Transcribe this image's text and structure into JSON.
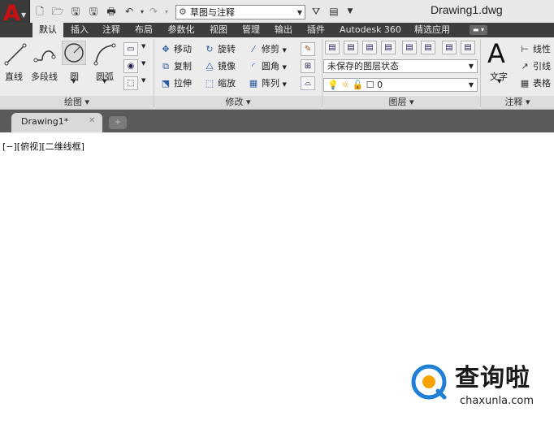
{
  "window": {
    "title": "Drawing1.dwg"
  },
  "app_button": {
    "logo": "A"
  },
  "quick_access": {
    "icons": [
      "new-file-icon",
      "open-folder-icon",
      "save-icon",
      "save-as-icon",
      "print-icon",
      "undo-icon",
      "redo-icon"
    ],
    "workspace": "草图与注释"
  },
  "tabs": [
    {
      "label": "默认",
      "active": true
    },
    {
      "label": "插入"
    },
    {
      "label": "注释"
    },
    {
      "label": "布局"
    },
    {
      "label": "参数化"
    },
    {
      "label": "视图"
    },
    {
      "label": "管理"
    },
    {
      "label": "输出"
    },
    {
      "label": "插件"
    },
    {
      "label": "Autodesk 360"
    },
    {
      "label": "精选应用"
    }
  ],
  "panels": {
    "draw": {
      "title": "绘图",
      "tools": {
        "line": "直线",
        "polyline": "多段线",
        "circle": "圆",
        "arc": "圆弧"
      }
    },
    "modify": {
      "title": "修改",
      "rows": [
        [
          "移动",
          "旋转",
          "修剪"
        ],
        [
          "复制",
          "镜像",
          "圆角"
        ],
        [
          "拉伸",
          "缩放",
          "阵列"
        ]
      ]
    },
    "layers": {
      "title": "图层",
      "state_combo": "未保存的图层状态",
      "layer_combo": "0"
    },
    "annotation": {
      "title": "注释",
      "text": "文字",
      "linear": "线性",
      "leader": "引线",
      "table": "表格"
    }
  },
  "file_tab": {
    "name": "Drawing1*"
  },
  "viewport": {
    "label": "[−][俯视][二维线框]"
  },
  "watermark": {
    "cn": "查询啦",
    "en": "chaxunla.com"
  }
}
